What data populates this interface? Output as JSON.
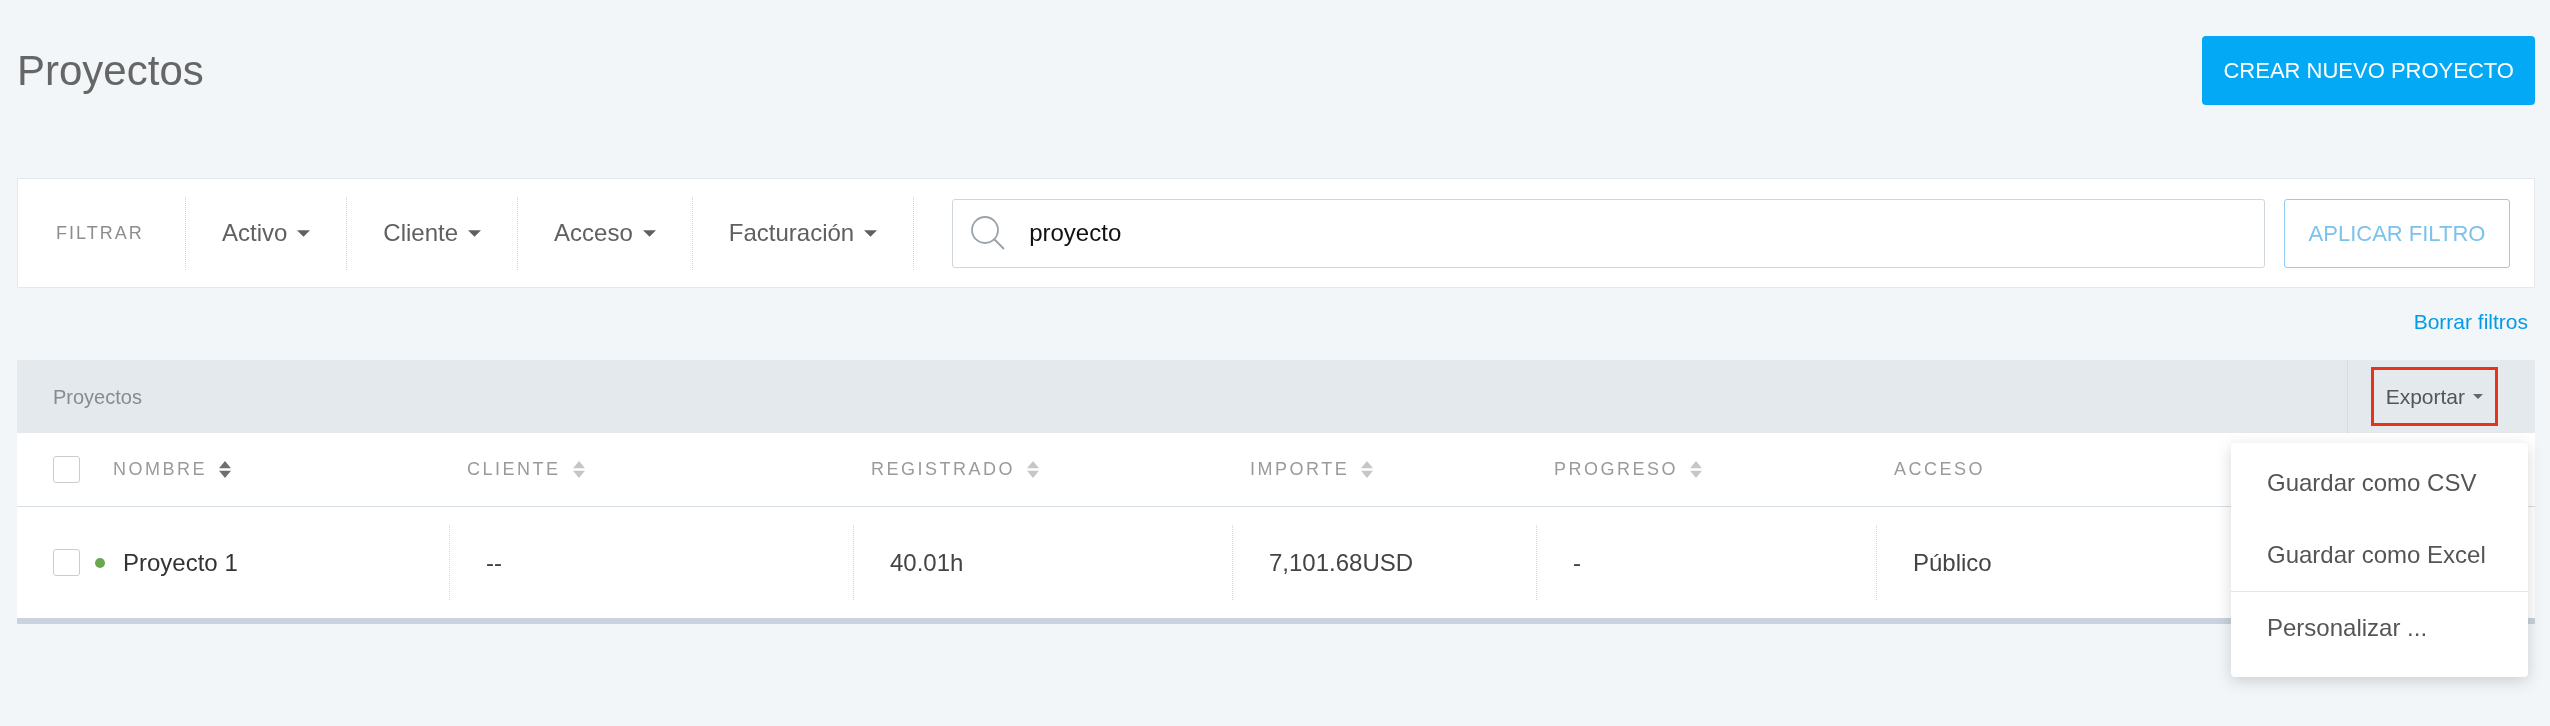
{
  "page": {
    "title": "Proyectos",
    "create_button": "CREAR NUEVO PROYECTO"
  },
  "filter_bar": {
    "label": "FILTRAR",
    "dropdowns": [
      {
        "label": "Activo"
      },
      {
        "label": "Cliente"
      },
      {
        "label": "Acceso"
      },
      {
        "label": "Facturación"
      }
    ],
    "search": {
      "value": "proyecto"
    },
    "apply_button": "APLICAR FILTRO",
    "clear_link": "Borrar filtros"
  },
  "table": {
    "title": "Proyectos",
    "export_button": {
      "label": "Exportar",
      "highlighted": true,
      "expanded": true,
      "menu_groups": [
        [
          "Guardar como CSV",
          "Guardar como Excel"
        ],
        [
          "Personalizar ..."
        ]
      ]
    },
    "header_checkbox": {
      "checked": false
    },
    "columns": [
      {
        "label": "NOMBRE",
        "sortable": true,
        "sort_active": true
      },
      {
        "label": "CLIENTE",
        "sortable": true,
        "sort_active": false
      },
      {
        "label": "REGISTRADO",
        "sortable": true,
        "sort_active": false
      },
      {
        "label": "IMPORTE",
        "sortable": true,
        "sort_active": false
      },
      {
        "label": "PROGRESO",
        "sortable": true,
        "sort_active": false
      },
      {
        "label": "ACCESO",
        "sortable": false
      }
    ],
    "rows": [
      {
        "checked": false,
        "color": "#6aa84f",
        "cells": [
          "Proyecto 1",
          "--",
          "40.01h",
          "7,101.68USD",
          "-",
          "Público"
        ]
      }
    ]
  }
}
